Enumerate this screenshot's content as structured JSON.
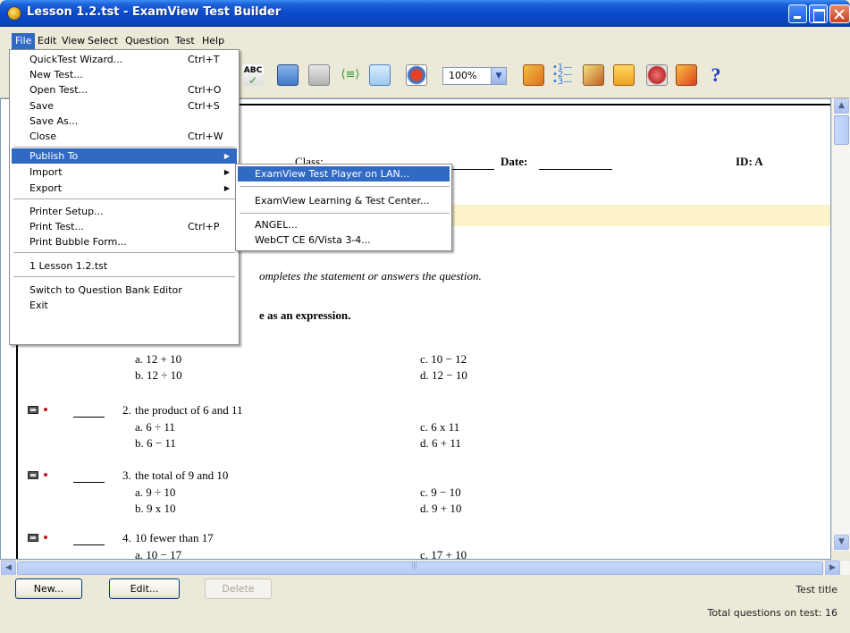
{
  "window": {
    "title": "Lesson 1.2.tst - ExamView Test Builder"
  },
  "menubar": [
    "File",
    "Edit",
    "View",
    "Select",
    "Question",
    "Test",
    "Help"
  ],
  "toolbar": {
    "zoom": "100%"
  },
  "file_menu": {
    "items": [
      {
        "label": "QuickTest Wizard...",
        "shortcut": "Ctrl+T"
      },
      {
        "label": "New Test...",
        "shortcut": ""
      },
      {
        "label": "Open Test...",
        "shortcut": "Ctrl+O"
      },
      {
        "label": "Save",
        "shortcut": "Ctrl+S"
      },
      {
        "label": "Save As...",
        "shortcut": ""
      },
      {
        "label": "Close",
        "shortcut": "Ctrl+W"
      },
      {
        "label": "Publish To",
        "shortcut": ""
      },
      {
        "label": "Import",
        "shortcut": ""
      },
      {
        "label": "Export",
        "shortcut": ""
      },
      {
        "label": "Printer Setup...",
        "shortcut": ""
      },
      {
        "label": "Print Test...",
        "shortcut": "Ctrl+P"
      },
      {
        "label": "Print Bubble Form...",
        "shortcut": ""
      },
      {
        "label": "1 Lesson 1.2.tst",
        "shortcut": ""
      },
      {
        "label": "Switch to Question Bank Editor",
        "shortcut": ""
      },
      {
        "label": "Exit",
        "shortcut": ""
      }
    ]
  },
  "publish_submenu": [
    "ExamView Test Player on LAN...",
    "ExamView Learning & Test Center...",
    "ANGEL...",
    "WebCT CE 6/Vista 3-4..."
  ],
  "document": {
    "class_label": "Class:",
    "date_label": "Date:",
    "id_label": "ID: A",
    "directions": "ompletes the statement or answers the question.",
    "section": "e as an expression.",
    "questions": [
      {
        "num": "",
        "stem": "",
        "a": "a.  12 + 10",
        "b": "b.  12 ÷ 10",
        "c": "c.  10 − 12",
        "d": "d.  12 − 10"
      },
      {
        "num": "2.",
        "stem": "the product of 6 and 11",
        "a": "a.  6 ÷ 11",
        "b": "b.  6 − 11",
        "c": "c.  6 x 11",
        "d": "d.  6 + 11"
      },
      {
        "num": "3.",
        "stem": "the total of 9 and 10",
        "a": "a.  9 ÷ 10",
        "b": "b.  9 x 10",
        "c": "c.  9 − 10",
        "d": "d.  9 + 10"
      },
      {
        "num": "4.",
        "stem": "10 fewer than 17",
        "a": "a.  10 − 17",
        "b": "",
        "c": "c.  17 + 10",
        "d": ""
      }
    ]
  },
  "bottom": {
    "new": "New...",
    "edit": "Edit...",
    "delete": "Delete",
    "test_title": "Test title",
    "total": "Total questions on test: 16"
  }
}
